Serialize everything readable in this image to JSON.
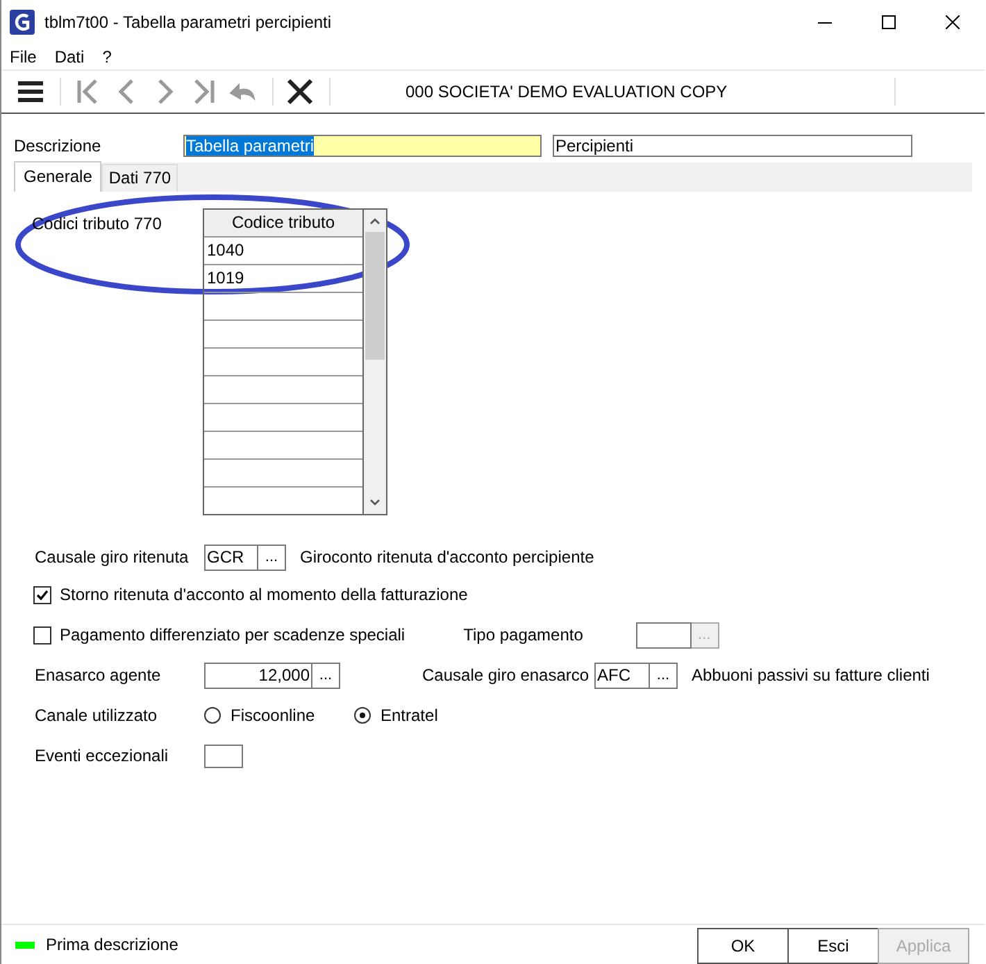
{
  "window": {
    "title": "tblm7t00 - Tabella parametri percipienti"
  },
  "menu": [
    {
      "label": "File"
    },
    {
      "label": "Dati"
    },
    {
      "label": "?"
    }
  ],
  "toolbar": {
    "tools": [
      {
        "kind": "menu",
        "disabled": false
      },
      {
        "kind": "first",
        "disabled": true
      },
      {
        "kind": "prev",
        "disabled": true
      },
      {
        "kind": "next",
        "disabled": true
      },
      {
        "kind": "last",
        "disabled": true
      },
      {
        "kind": "undo",
        "disabled": true
      },
      {
        "kind": "close",
        "disabled": false
      }
    ],
    "company": "000 SOCIETA'  DEMO EVALUATION COPY"
  },
  "descrizione": {
    "label": "Descrizione",
    "value": "Tabella parametri",
    "focused": true,
    "value_2": "Percipienti"
  },
  "tabs": [
    {
      "label": "Generale",
      "selected": true
    },
    {
      "label": "Dati 770",
      "selected": false
    }
  ],
  "codici_tributo": {
    "label": "Codici tributo 770",
    "column": "Codice tributo",
    "rows": [
      "1040",
      "1019"
    ]
  },
  "causale_giro_ritenuta": {
    "label": "Causale giro ritenuta",
    "value": "GCR",
    "button": "...",
    "description": "Giroconto ritenuta d'acconto percipiente"
  },
  "storno": {
    "label": "Storno ritenuta d'acconto al momento della fatturazione",
    "checked": true
  },
  "pagamento_differenziato": {
    "label": "Pagamento differenziato per scadenze speciali",
    "checked": false
  },
  "tipo_pagamento": {
    "label": "Tipo pagamento",
    "button": "...",
    "disabled": true
  },
  "enasarco_agente": {
    "label": "Enasarco  agente",
    "value": "12,000",
    "button": "..."
  },
  "causale_giro_enasarco": {
    "label": "Causale giro enasarco",
    "value": "AFC",
    "button": "...",
    "description": "Abbuoni passivi su fatture clienti"
  },
  "canale": {
    "label": "Canale utilizzato",
    "options": [
      {
        "label": "Fiscoonline",
        "selected": false
      },
      {
        "label": "Entratel",
        "selected": true
      }
    ]
  },
  "eventi": {
    "label": "Eventi eccezionali"
  },
  "annotations": [
    {
      "kind": "ellipse",
      "color": "#3b47c9"
    }
  ],
  "status": {
    "text": "Prima descrizione",
    "color": "#00ff00"
  },
  "buttons": [
    {
      "label": "OK",
      "disabled": false
    },
    {
      "label": "Esci",
      "disabled": false
    },
    {
      "label": "Applica",
      "disabled": true
    }
  ]
}
